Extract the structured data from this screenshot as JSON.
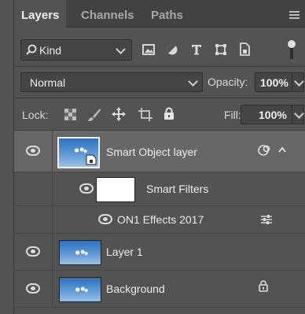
{
  "tabs": [
    {
      "label": "Layers",
      "active": true
    },
    {
      "label": "Channels",
      "active": false
    },
    {
      "label": "Paths",
      "active": false
    }
  ],
  "filter": {
    "label": "Kind",
    "search_icon": "search-icon"
  },
  "blend": {
    "mode": "Normal",
    "opacity_label": "Opacity:",
    "opacity_value": "100%"
  },
  "lock": {
    "label": "Lock:",
    "fill_label": "Fill:",
    "fill_value": "100%"
  },
  "layers": {
    "smart_object": {
      "name": "Smart Object layer"
    },
    "smart_filters": {
      "name": "Smart Filters"
    },
    "filter_effect": {
      "name": "ON1 Effects 2017"
    },
    "layer1": {
      "name": "Layer 1"
    },
    "background": {
      "name": "Background"
    }
  },
  "colors": {
    "panel": "#535353",
    "tabbar": "#424242",
    "selected_row": "#676767",
    "control": "#454545"
  }
}
